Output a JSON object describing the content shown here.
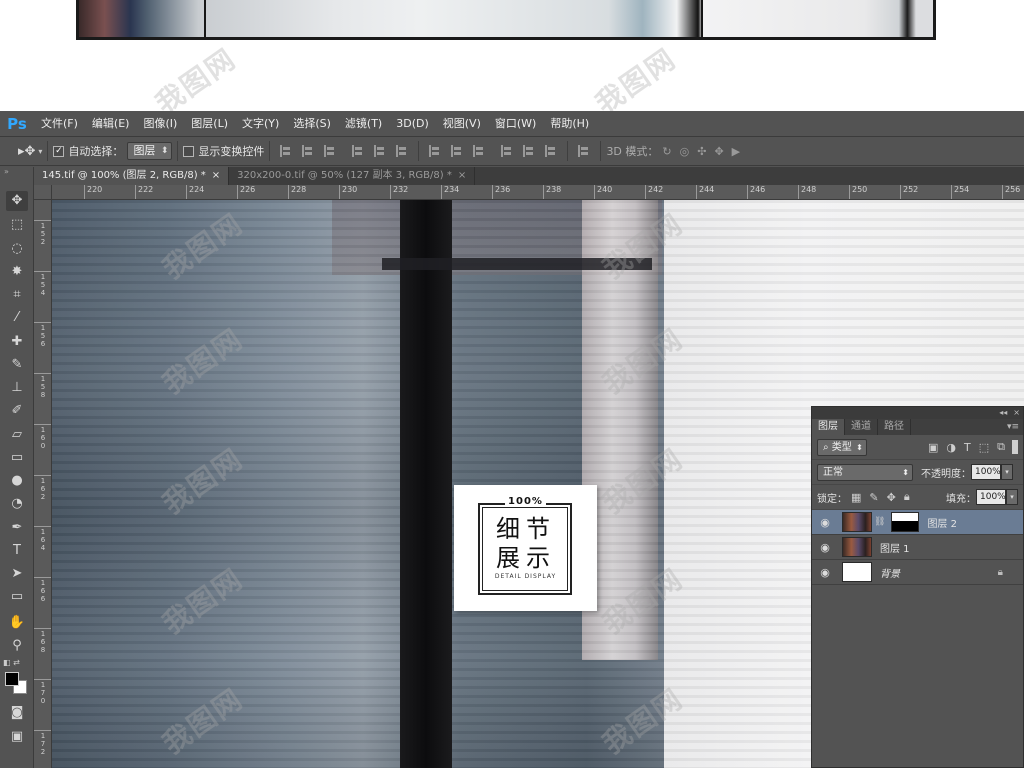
{
  "app": {
    "logo": "Ps"
  },
  "menu": [
    "文件(F)",
    "编辑(E)",
    "图像(I)",
    "图层(L)",
    "文字(Y)",
    "选择(S)",
    "滤镜(T)",
    "3D(D)",
    "视图(V)",
    "窗口(W)",
    "帮助(H)"
  ],
  "options": {
    "auto_select_label": "自动选择：",
    "auto_select_value": "图层",
    "show_transform_label": "显示变换控件",
    "mode_3d_label": "3D 模式："
  },
  "tabs": [
    {
      "label": "145.tif @ 100% (图层 2, RGB/8) *",
      "active": true
    },
    {
      "label": "320x200-0.tif @ 50% (127 副本 3, RGB/8) *",
      "active": false
    }
  ],
  "ruler": {
    "top_ticks": [
      "220",
      "222",
      "224",
      "226",
      "228",
      "230",
      "232",
      "234",
      "236",
      "238",
      "240",
      "242",
      "244",
      "246",
      "248",
      "250",
      "252",
      "254",
      "256"
    ],
    "left_ticks": [
      "152",
      "154",
      "156",
      "158",
      "160",
      "162",
      "164",
      "166",
      "168",
      "170",
      "172"
    ]
  },
  "badge": {
    "percent": "100%",
    "line1": "细节",
    "line2": "展示",
    "subtitle": "DETAIL DISPLAY"
  },
  "layers_panel": {
    "tabs": [
      "图层",
      "通道",
      "路径"
    ],
    "filter_value": "类型",
    "blend_mode": "正常",
    "opacity_label": "不透明度：",
    "opacity_value": "100%",
    "lock_label": "锁定：",
    "fill_label": "填充：",
    "fill_value": "100%",
    "layers": [
      {
        "name": "图层 2",
        "selected": true,
        "has_mask": true
      },
      {
        "name": "图层 1",
        "selected": false,
        "has_mask": false
      },
      {
        "name": "背景",
        "selected": false,
        "locked": true
      }
    ]
  },
  "colors": {
    "ps_bg": "#535353",
    "logo_blue": "#31a8ff",
    "selected_layer": "#6a7c94"
  }
}
